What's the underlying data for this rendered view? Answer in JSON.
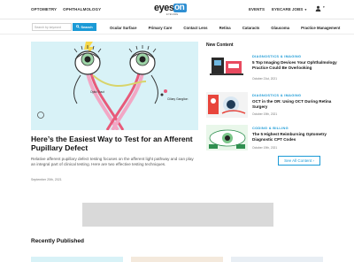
{
  "topnav": {
    "items": [
      "OPTOMETRY",
      "OPHTHALMOLOGY"
    ]
  },
  "logo": {
    "eyes": "eyes",
    "on": "on",
    "tagline": "EYECARE"
  },
  "rightnav": {
    "events": "EVENTS",
    "jobs": "EYECARE JOBS",
    "jobs_caret": "▾",
    "user_caret": "▾"
  },
  "search": {
    "placeholder": "Search by keyword",
    "button": "Search"
  },
  "categories": [
    "Ocular Surface",
    "Primary Care",
    "Contact Lens",
    "Retina",
    "Cataracts",
    "Glaucoma",
    "Practice Management"
  ],
  "hero": {
    "label_optic": "Optic Tract",
    "label_ciliary": "Ciliary Ganglion",
    "title": "Here’s the Easiest Way to Test for an Afferent Pupillary Defect",
    "description": "Relative afferent pupillary defect testing focuses on the afferent light pathway and can play an integral part of clinical testing. Here are two effective testing techniques.",
    "date": "September 20th, 2021"
  },
  "sidebar": {
    "heading": "New Content",
    "items": [
      {
        "category": "DIAGNOSTICS & IMAGING",
        "title": "5 Top Imaging Devices Your Ophthalmology Practice Could Be Overlooking",
        "date": "October 21st, 2021"
      },
      {
        "category": "DIAGNOSTICS & IMAGING",
        "title": "OCT in the OR: Using OCT During Retina Surgery",
        "date": "October 19th, 2021"
      },
      {
        "category": "CODING & BILLING",
        "title": "The 5 Highest Reimbursing Optometry Diagnostic CPT Codes",
        "date": "October 19th, 2021"
      }
    ],
    "see_all": "See All Content ›"
  },
  "recent": {
    "heading": "Recently Published"
  },
  "colors": {
    "accent": "#1b9ad6",
    "hero_bg": "#d8f2f7",
    "ad_gray": "#d9d9d9"
  }
}
